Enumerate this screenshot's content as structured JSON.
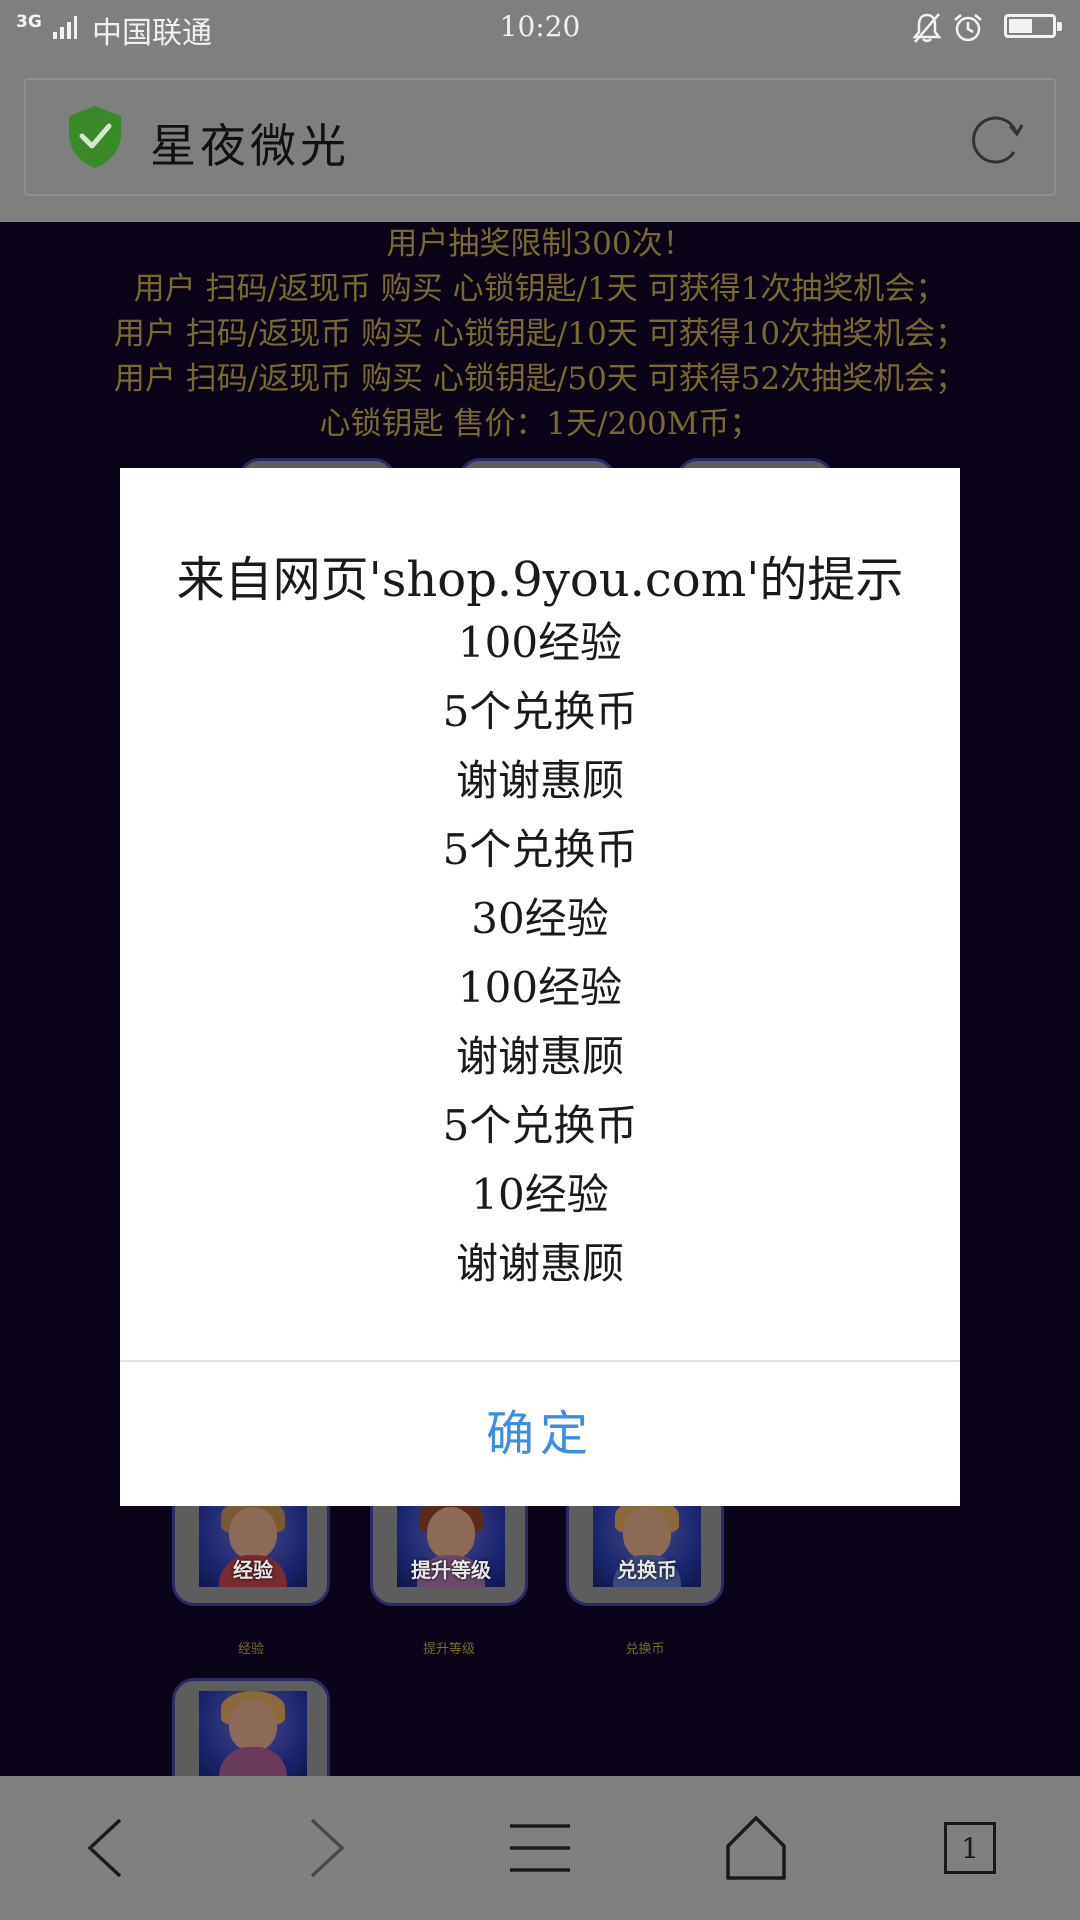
{
  "status_bar": {
    "network": "3G",
    "carrier": "中国联通",
    "time": "10:20",
    "battery_level": 0.55
  },
  "toolbar": {
    "site_title": "星夜微光"
  },
  "page": {
    "notice_lines": [
      "用户抽奖限制300次！",
      "用户 扫码/返现币 购买 心锁钥匙/1天 可获得1次抽奖机会；",
      "用户 扫码/返现币 购买 心锁钥匙/10天 可获得10次抽奖机会；",
      "用户 扫码/返现币 购买 心锁钥匙/50天 可获得52次抽奖机会；",
      "心锁钥匙 售价：1天/200M币；"
    ],
    "prize_cards": [
      {
        "label": "经验",
        "caption": "经验"
      },
      {
        "label": "提升等级",
        "caption": "提升等级"
      },
      {
        "label": "兑换币",
        "caption": "兑换币"
      }
    ],
    "accent_text_color": "#7a6a30"
  },
  "dialog": {
    "title": "来自网页'shop.9you.com'的提示",
    "lines": [
      "100经验",
      "5个兑换币",
      "谢谢惠顾",
      "5个兑换币",
      "30经验",
      "100经验",
      "谢谢惠顾",
      "5个兑换币",
      "10经验",
      "谢谢惠顾"
    ],
    "ok_label": "确定",
    "ok_color": "#3a8ee6"
  },
  "bottom_nav": {
    "tab_count": "1",
    "icons": [
      "back-icon",
      "forward-icon",
      "menu-icon",
      "home-icon",
      "tabs-icon"
    ]
  }
}
